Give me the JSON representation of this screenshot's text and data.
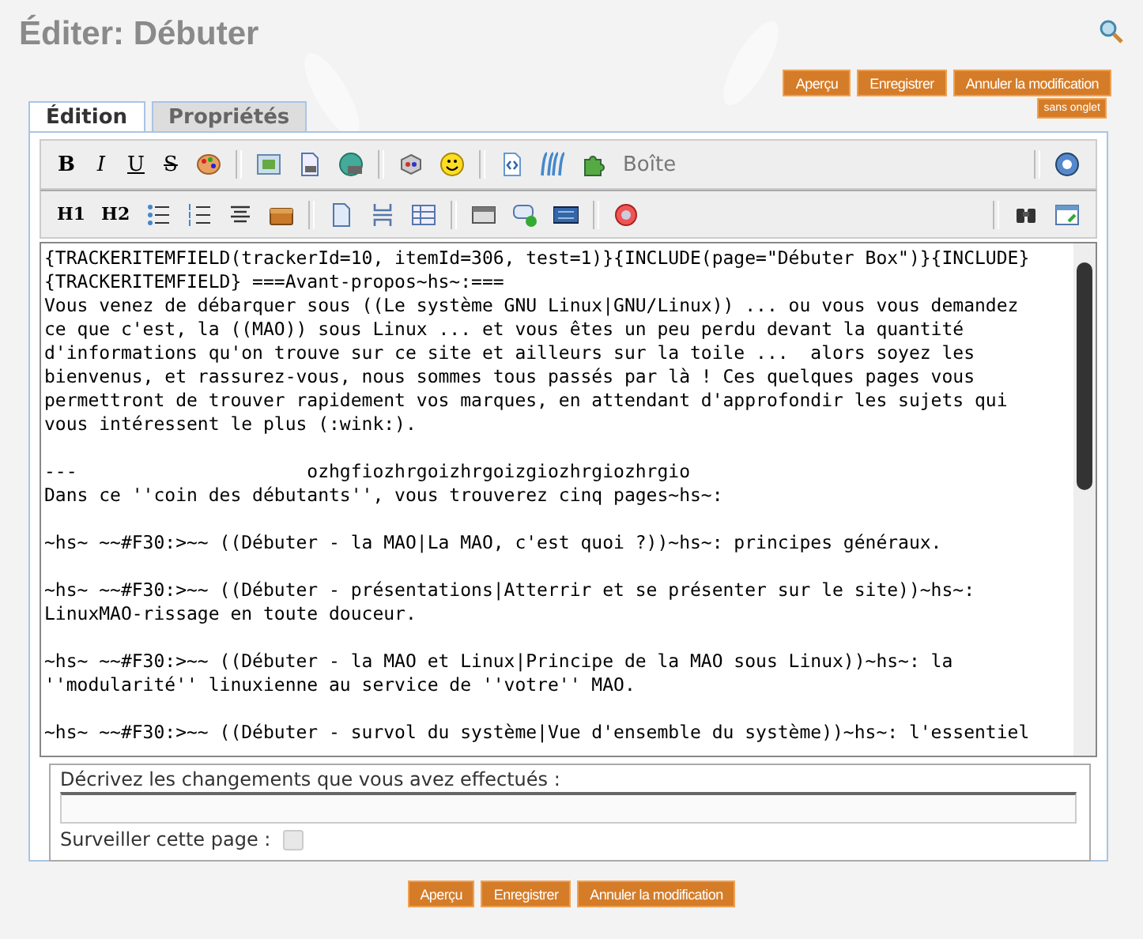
{
  "title": "Éditer: Débuter",
  "top_buttons": [
    "Aperçu",
    "Enregistrer",
    "Annuler la modification"
  ],
  "tabs": [
    {
      "label": "Édition",
      "selected": true
    },
    {
      "label": "Propriétés",
      "selected": false
    }
  ],
  "no_tab_button": "sans onglet",
  "toolbar": {
    "format_buttons": [
      {
        "label": "B",
        "kind": "bold"
      },
      {
        "label": "I",
        "kind": "italic"
      },
      {
        "label": "U",
        "kind": "underline"
      },
      {
        "label": "S",
        "kind": "strike"
      }
    ],
    "heading_buttons": [
      "H1",
      "H2"
    ],
    "box_label": "Boîte"
  },
  "editor": {
    "paragraphs": [
      [
        "{TRACKERITEMFIELD(trackerId=10, itemId=306, test=1)}{INCLUDE(page=\"Débuter Box\")}{INCLUDE}",
        "{TRACKERITEMFIELD} ===Avant-propos~hs~:===",
        "Vous venez de débarquer sous ((Le système GNU Linux|GNU/Linux)) ... ou vous vous demandez",
        "ce que c'est, la ((MAO)) sous Linux ... et vous êtes un peu perdu devant la quantité",
        "d'informations qu'on trouve sur ce site et ailleurs sur la toile ...  alors soyez les",
        "bienvenus, et rassurez-vous, nous sommes tous passés par là ! Ces quelques pages vous",
        "permettront de trouver rapidement vos marques, en attendant d'approfondir les sujets qui",
        "vous intéressent le plus (:wink:)."
      ],
      [
        "---                     ozhgfiozhrgoizhrgoizgiozhrgiozhrgio",
        "Dans ce ''coin des débutants'', vous trouverez cinq pages~hs~:"
      ],
      [
        "~hs~ ~~#F30:>~~ ((Débuter - la MAO|La MAO, c'est quoi ?))~hs~: principes généraux."
      ],
      [
        "~hs~ ~~#F30:>~~ ((Débuter - présentations|Atterrir et se présenter sur le site))~hs~:",
        "LinuxMAO-rissage en toute douceur."
      ],
      [
        "~hs~ ~~#F30:>~~ ((Débuter - la MAO et Linux|Principe de la MAO sous Linux))~hs~: la",
        "''modularité'' linuxienne au service de ''votre'' MAO."
      ],
      [
        "~hs~ ~~#F30:>~~ ((Débuter - survol du système|Vue d'ensemble du système))~hs~: l'essentiel"
      ]
    ]
  },
  "summary": {
    "label": "Décrivez les changements que vous avez effectués :"
  },
  "watch": {
    "label": "Surveiller cette page :",
    "checked": false
  },
  "bottom_buttons": [
    "Aperçu",
    "Enregistrer",
    "Annuler la modification"
  ]
}
